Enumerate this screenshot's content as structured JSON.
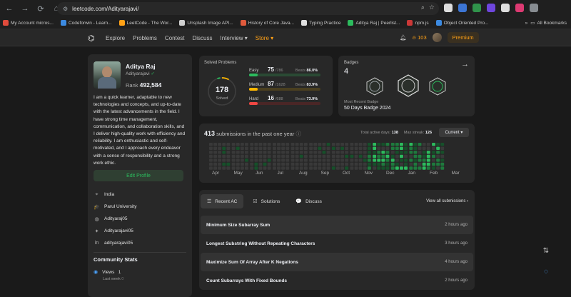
{
  "browser": {
    "url": "leetcode.com/Adityarajavi/",
    "bookmarks": [
      {
        "label": "My Account micros...",
        "color": "#e04b3c"
      },
      {
        "label": "Codeforwin - Learn...",
        "color": "#3c8ae0"
      },
      {
        "label": "LeetCode - The Wor...",
        "color": "#ffa116"
      },
      {
        "label": "Unsplash Image API...",
        "color": "#d0d0d0"
      },
      {
        "label": "History of Core Java...",
        "color": "#e05a3c"
      },
      {
        "label": "Typing Practice",
        "color": "#e0e0e0"
      },
      {
        "label": "Aditya Raj | Peerlist...",
        "color": "#2cbb5d"
      },
      {
        "label": "npm.js",
        "color": "#cb3837"
      },
      {
        "label": "Object Oriented Pro...",
        "color": "#3c8ae0"
      }
    ],
    "all_bookmarks": "All Bookmarks",
    "extension_colors": [
      "#ffffff",
      "#4285f4",
      "#34a853",
      "#7c4dff",
      "#ffffff",
      "#ff4081",
      "#9aa0a6"
    ]
  },
  "nav": {
    "logo": "⌬",
    "links": [
      "Explore",
      "Problems",
      "Contest",
      "Discuss",
      "Interview ▾"
    ],
    "store": "Store ▾",
    "coins": "103",
    "premium": "Premium"
  },
  "profile": {
    "name": "Aditya Raj",
    "handle": "Adityarajavi",
    "rank_label": "Rank",
    "rank": "492,584",
    "bio": "I am a quick learner, adaptable to new technologies and concepts, and up-to-date with the latest advancements in the field. I have strong time management, communication, and collaboration skills, and I deliver high-quality work with efficiency and reliability. I am enthusiastic and self-motivated, and I approach every endeavor with a sense of responsibility and a strong work ethic.",
    "edit_button": "Edit Profile",
    "info": [
      {
        "icon": "location-icon",
        "glyph": "⌖",
        "text": "India"
      },
      {
        "icon": "school-icon",
        "glyph": "🎓",
        "text": "Parul University"
      },
      {
        "icon": "github-icon",
        "glyph": "◍",
        "text": "Adityaraj05"
      },
      {
        "icon": "twitter-icon",
        "glyph": "✦",
        "text": "Adityarajavi05"
      },
      {
        "icon": "linkedin-icon",
        "glyph": "in",
        "text": "adityarajavi05"
      }
    ],
    "community_title": "Community Stats",
    "views_label": "Views",
    "views": "1",
    "last_week": "Last week"
  },
  "solved": {
    "title": "Solved Problems",
    "total": "178",
    "total_label": "Solved",
    "rows": [
      {
        "name": "Easy",
        "count": "75",
        "total": "/786",
        "beats_label": "Beats",
        "beats": "86.0%",
        "fill": 0.095,
        "color": "#2cbb5d",
        "track": "#2a4a34"
      },
      {
        "name": "Medium",
        "count": "87",
        "total": "/1628",
        "beats_label": "Beats",
        "beats": "83.9%",
        "fill": 0.053,
        "color": "#ffb800",
        "track": "#4a3f20"
      },
      {
        "name": "Hard",
        "count": "16",
        "total": "/688",
        "beats_label": "Beats",
        "beats": "73.9%",
        "fill": 0.023,
        "color": "#ef4743",
        "track": "#4a2626"
      }
    ]
  },
  "badges": {
    "title": "Badges",
    "count": "4",
    "recent_label": "Most Recent Badge",
    "recent": "50 Days Badge 2024"
  },
  "calendar": {
    "count": "413",
    "label": "submissions in the past one year",
    "active_label": "Total active days:",
    "active": "138",
    "streak_label": "Max streak:",
    "streak": "126",
    "select": "Current ▾",
    "months": [
      "Apr",
      "May",
      "Jun",
      "Jul",
      "Aug",
      "Sep",
      "Oct",
      "Nov",
      "Dec",
      "Jan",
      "Feb",
      "Mar"
    ]
  },
  "submissions": {
    "tabs": [
      {
        "label": "Recent AC",
        "icon": "list-icon",
        "glyph": "☰"
      },
      {
        "label": "Solutions",
        "icon": "solutions-icon",
        "glyph": "☑"
      },
      {
        "label": "Discuss",
        "icon": "discuss-icon",
        "glyph": "💬"
      }
    ],
    "view_all": "View all submissions ›",
    "rows": [
      {
        "title": "Minimum Size Subarray Sum",
        "time": "2 hours ago"
      },
      {
        "title": "Longest Substring Without Repeating Characters",
        "time": "3 hours ago"
      },
      {
        "title": "Maximize Sum Of Array After K Negations",
        "time": "4 hours ago"
      },
      {
        "title": "Count Subarrays With Fixed Bounds",
        "time": "2 hours ago"
      }
    ]
  }
}
